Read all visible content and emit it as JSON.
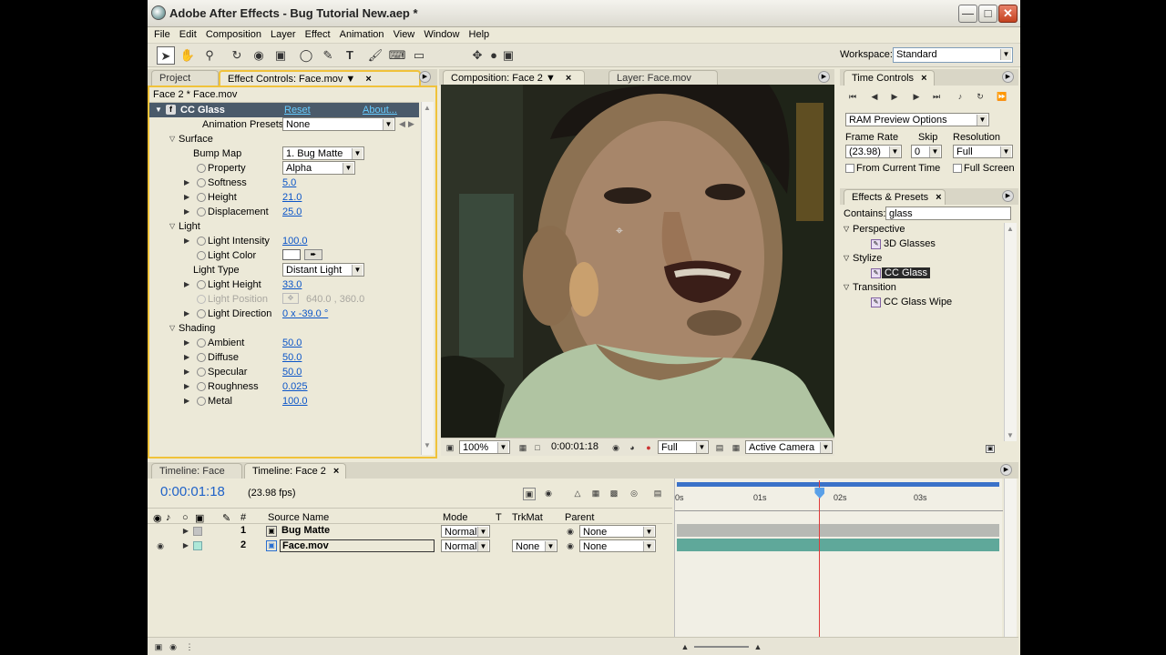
{
  "window": {
    "title": "Adobe After Effects - Bug Tutorial New.aep *"
  },
  "menu": [
    "File",
    "Edit",
    "Composition",
    "Layer",
    "Effect",
    "Animation",
    "View",
    "Window",
    "Help"
  ],
  "toolbar": {
    "workspace_label": "Workspace:",
    "workspace_value": "Standard"
  },
  "effect_panel": {
    "tab_project": "Project",
    "tab_effect": "Effect Controls: Face.mov",
    "header": "Face 2 * Face.mov",
    "effect_name": "CC Glass",
    "reset": "Reset",
    "about": "About...",
    "anim_presets_label": "Animation Presets:",
    "anim_presets_value": "None",
    "surface": "Surface",
    "bump_map": "Bump Map",
    "bump_map_val": "1. Bug Matte",
    "property": "Property",
    "property_val": "Alpha",
    "softness": "Softness",
    "softness_val": "5.0",
    "height": "Height",
    "height_val": "21.0",
    "displacement": "Displacement",
    "displacement_val": "25.0",
    "light": "Light",
    "light_intensity": "Light Intensity",
    "light_intensity_val": "100.0",
    "light_color": "Light Color",
    "light_type": "Light Type",
    "light_type_val": "Distant Light",
    "light_height": "Light Height",
    "light_height_val": "33.0",
    "light_position": "Light Position",
    "light_position_val": "640.0 , 360.0",
    "light_direction": "Light Direction",
    "light_direction_val": "0 x -39.0 °",
    "shading": "Shading",
    "ambient": "Ambient",
    "ambient_val": "50.0",
    "diffuse": "Diffuse",
    "diffuse_val": "50.0",
    "specular": "Specular",
    "specular_val": "50.0",
    "roughness": "Roughness",
    "roughness_val": "0.025",
    "metal": "Metal",
    "metal_val": "100.0"
  },
  "comp_panel": {
    "tab_comp": "Composition: Face 2",
    "tab_layer": "Layer: Face.mov",
    "zoom": "100%",
    "timecode": "0:00:01:18",
    "resolution": "Full",
    "camera": "Active Camera"
  },
  "time_controls": {
    "tab": "Time Controls",
    "ram_preview": "RAM Preview Options",
    "frame_rate_label": "Frame Rate",
    "frame_rate_val": "(23.98)",
    "skip_label": "Skip",
    "skip_val": "0",
    "resolution_label": "Resolution",
    "resolution_val": "Full",
    "from_current": "From Current Time",
    "full_screen": "Full Screen"
  },
  "effects_presets": {
    "tab": "Effects & Presets",
    "contains_label": "Contains:",
    "contains_val": "glass",
    "cat1": "Perspective",
    "item1": "3D Glasses",
    "cat2": "Stylize",
    "item2": "CC Glass",
    "cat3": "Transition",
    "item3": "CC Glass Wipe"
  },
  "timeline": {
    "tab1": "Timeline: Face",
    "tab2": "Timeline: Face 2",
    "timecode": "0:00:01:18",
    "fps": "(23.98 fps)",
    "col_source": "Source Name",
    "col_mode": "Mode",
    "col_t": "T",
    "col_trkmat": "TrkMat",
    "col_parent": "Parent",
    "layers": [
      {
        "num": "1",
        "name": "Bug Matte",
        "mode": "Normal",
        "trkmat": "",
        "parent": "None"
      },
      {
        "num": "2",
        "name": "Face.mov",
        "mode": "Normal",
        "trkmat": "None",
        "parent": "None"
      }
    ],
    "ruler": [
      "0s",
      "01s",
      "02s",
      "03s"
    ],
    "playhead_fraction": 0.442
  }
}
